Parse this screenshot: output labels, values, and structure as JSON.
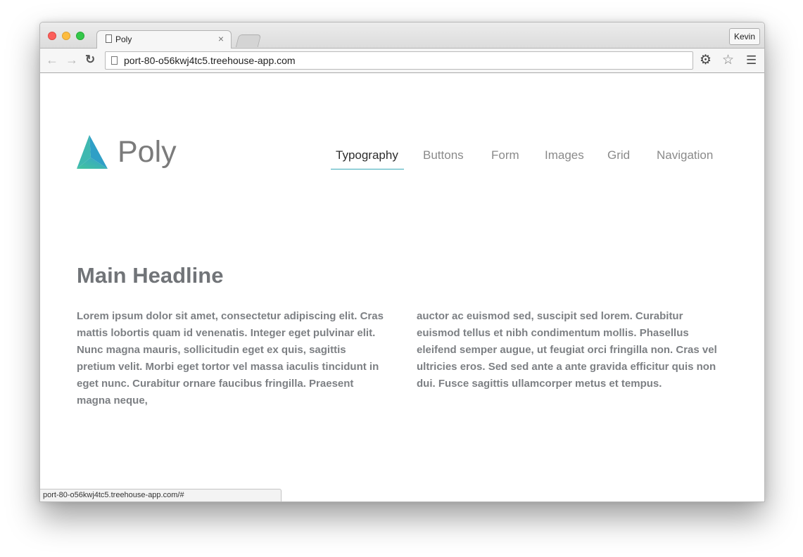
{
  "browser": {
    "tab_title": "Poly",
    "tab_close": "×",
    "profile_name": "Kevin",
    "url": "port-80-o56kwj4tc5.treehouse-app.com",
    "status_url": "port-80-o56kwj4tc5.treehouse-app.com/#",
    "icons": {
      "back": "back-arrow-icon",
      "forward": "forward-arrow-icon",
      "reload": "reload-icon",
      "extension": "gear-icon",
      "bookmark": "star-icon",
      "menu": "hamburger-menu-icon"
    }
  },
  "site": {
    "logo_text": "Poly",
    "logo_colors": [
      "#3ec1a0",
      "#3aa6c9"
    ],
    "accent_color": "#3aaab8",
    "nav": [
      {
        "label": "Typography",
        "active": true
      },
      {
        "label": "Buttons",
        "active": false
      },
      {
        "label": "Form",
        "active": false
      },
      {
        "label": "Images",
        "active": false
      },
      {
        "label": "Grid",
        "active": false
      },
      {
        "label": "Navigation",
        "active": false
      }
    ],
    "headline": "Main Headline",
    "paragraph_1": "Lorem ipsum dolor sit amet, consectetur adipiscing elit. Cras mattis lobortis quam id venenatis. Integer eget pulvinar elit. Nunc magna mauris, sollicitudin eget ex quis, sagittis pretium velit. Morbi eget tortor vel massa iaculis tincidunt in eget nunc. Curabitur ornare faucibus fringilla. Praesent magna neque,",
    "paragraph_2": "auctor ac euismod sed, suscipit sed lorem. Curabitur euismod tellus et nibh condimentum mollis. Phasellus eleifend semper augue, ut feugiat orci fringilla non. Cras vel ultricies eros. Sed sed ante a ante gravida efficitur quis non dui. Fusce sagittis ullamcorper metus et tempus."
  }
}
